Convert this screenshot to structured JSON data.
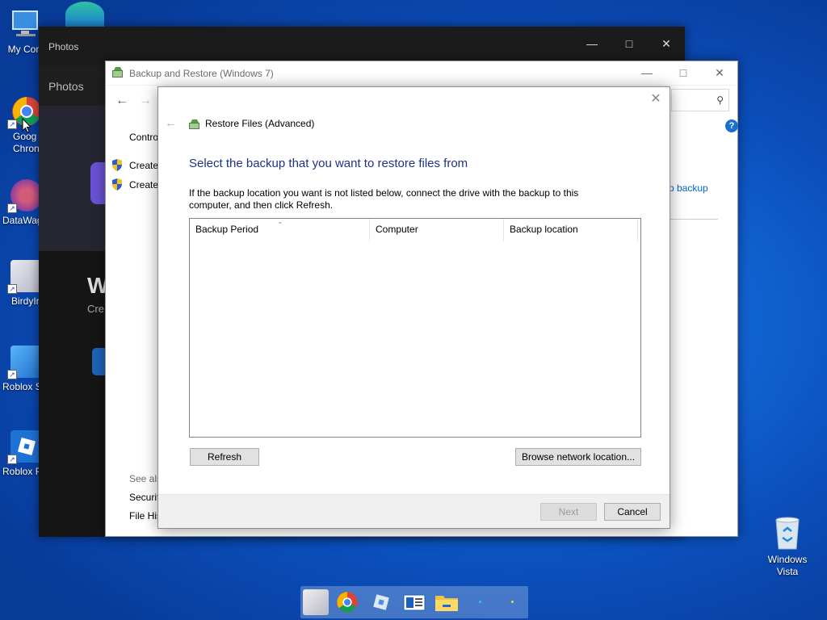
{
  "desktop": {
    "icons": [
      {
        "label": "My Com",
        "icon": "computer-icon"
      },
      {
        "label": "Goog Chron",
        "icon": "chrome-icon"
      },
      {
        "label": "DataWag",
        "icon": "datawagon-icon"
      },
      {
        "label": "BirdyIr",
        "icon": "birdy-icon"
      },
      {
        "label": "Roblox S",
        "icon": "roblox-studio-icon"
      },
      {
        "label": "Roblox P",
        "icon": "roblox-player-icon"
      }
    ],
    "recycle_bin": {
      "label": "Windows Vista",
      "icon": "recycle-bin-icon"
    }
  },
  "photos_window": {
    "title": "Photos",
    "app_header": "Photos",
    "partial_big_text": "W",
    "partial_sub_text": "Cre"
  },
  "backup_window": {
    "title": "Backup and Restore (Windows 7)",
    "control_panel_text": "Contro",
    "links": [
      "Create",
      "Create"
    ],
    "right_link": "p backup",
    "see_also": "See als",
    "see_also_links": [
      "Securit",
      "File His"
    ],
    "help_label": "?"
  },
  "dialog": {
    "title": "Restore Files (Advanced)",
    "heading": "Select the backup that you want to restore files from",
    "instruction": "If the backup location you want is not listed below, connect the drive with the backup to this computer, and then click Refresh.",
    "columns": [
      "Backup Period",
      "Computer",
      "Backup location"
    ],
    "rows": [],
    "buttons": {
      "refresh": "Refresh",
      "browse": "Browse network location...",
      "next": "Next",
      "cancel": "Cancel"
    }
  },
  "taskbar": {
    "items": [
      "birdy-icon",
      "chrome-icon",
      "roblox-icon",
      "news-icon",
      "file-explorer-icon"
    ]
  },
  "colors": {
    "heading_blue": "#1e3287",
    "link_blue": "#0066cc",
    "desktop_blue": "#136ad9"
  }
}
